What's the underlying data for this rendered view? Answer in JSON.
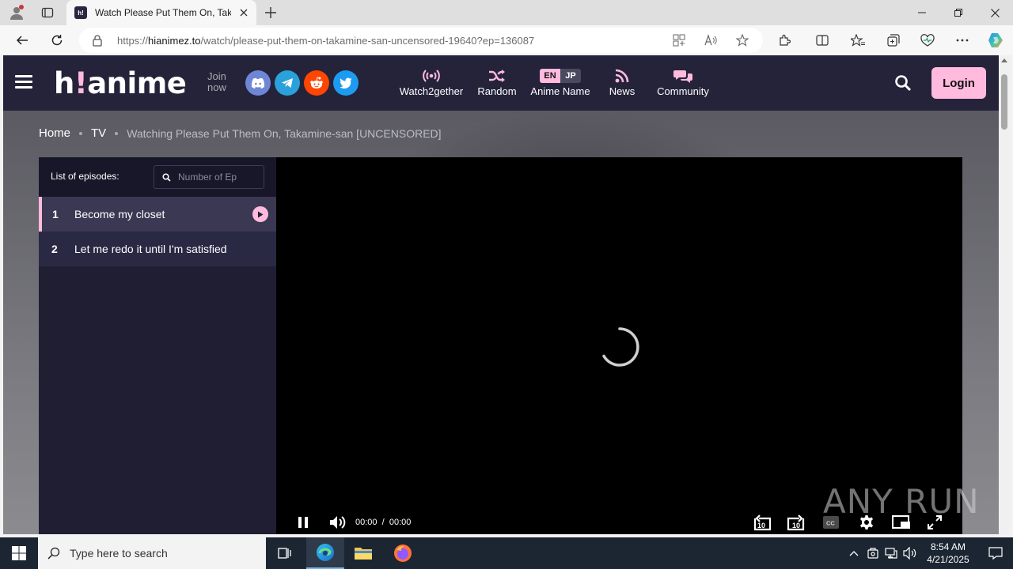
{
  "browser": {
    "tab_title": "Watch Please Put Them On, Takamine-san [UNCENSORED]",
    "tab_favicon": "h!",
    "url_prefix": "https://",
    "url_domain": "hianimez.to",
    "url_path": "/watch/please-put-them-on-takamine-san-uncensored-19640?ep=136087"
  },
  "site": {
    "logo_main": "h",
    "logo_bang": "!",
    "logo_rest": "anime",
    "join_now": "Join now",
    "nav": {
      "watch2gether": "Watch2gether",
      "random": "Random",
      "lang_en": "EN",
      "lang_jp": "JP",
      "anime_name": "Anime Name",
      "news": "News",
      "community": "Community"
    },
    "login": "Login",
    "accent": "#ffbade",
    "header_bg": "#24233a"
  },
  "breadcrumb": {
    "home": "Home",
    "tv": "TV",
    "current": "Watching Please Put Them On, Takamine-san [UNCENSORED]"
  },
  "episodes": {
    "header": "List of episodes:",
    "search_placeholder": "Number of Ep",
    "items": [
      {
        "num": "1",
        "title": "Become my closet",
        "active": true
      },
      {
        "num": "2",
        "title": "Let me redo it until I'm satisfied",
        "active": false
      }
    ]
  },
  "player": {
    "current_time": "00:00",
    "separator": "/",
    "duration": "00:00",
    "rewind_label": "10",
    "forward_label": "10",
    "cc_label": "CC"
  },
  "watermark": "ANY RUN",
  "taskbar": {
    "search_text": "Type here to search",
    "time": "8:54 AM",
    "date": "4/21/2025"
  }
}
